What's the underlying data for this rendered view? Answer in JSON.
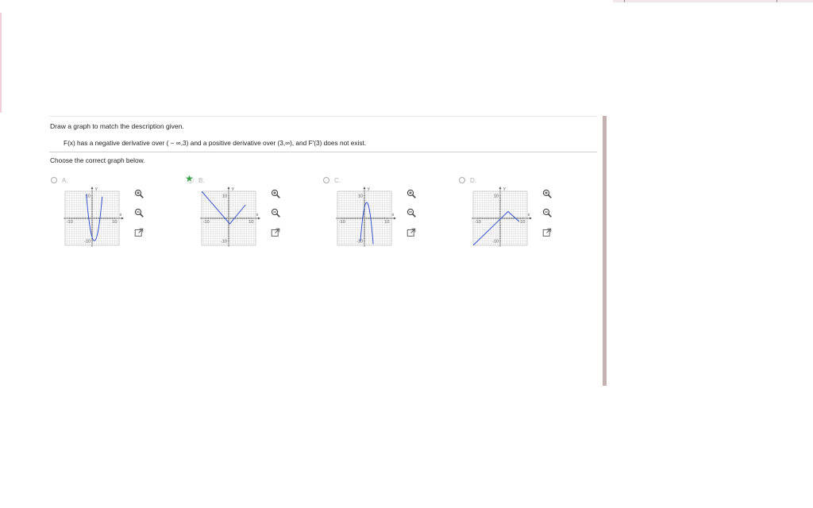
{
  "prompt": "Draw a graph to match the description given.",
  "description": "F(x) has a negative derivative over ( − ∞,3) and a positive derivative over (3,∞), and F′(3) does not exist.",
  "instruction": "Choose the correct graph below.",
  "options": [
    {
      "letter": "A.",
      "selected": false,
      "curve": "parabola-up"
    },
    {
      "letter": "B.",
      "selected": true,
      "curve": "v-shape"
    },
    {
      "letter": "C.",
      "selected": false,
      "curve": "parabola-down"
    },
    {
      "letter": "D.",
      "selected": false,
      "curve": "inverted-v"
    }
  ],
  "graph_labels": {
    "y_axis": "y",
    "x_axis": "x",
    "y_top": "10",
    "y_bottom": "-10",
    "x_left": "-10",
    "x_right": "10"
  },
  "colors": {
    "curve": "#2244cc",
    "grid": "#d6d6d6",
    "axis": "#555555",
    "selected_star": "#3aa24a",
    "scrollbar": "#c6b1b1"
  },
  "icons": {
    "zoom_in": "zoom-in-icon",
    "zoom_out": "zoom-out-icon",
    "popout": "popout-icon"
  }
}
